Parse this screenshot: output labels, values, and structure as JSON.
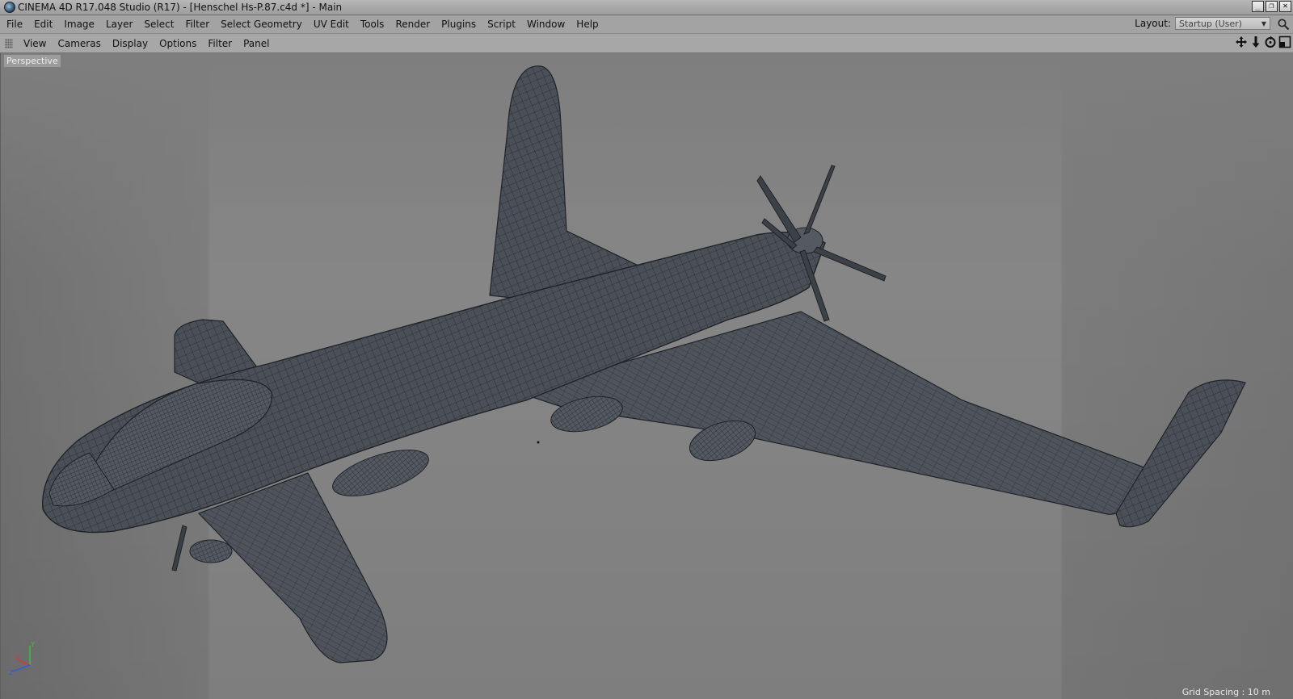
{
  "window": {
    "title": "CINEMA 4D R17.048 Studio (R17) - [Henschel Hs-P.87.c4d *] - Main",
    "controls": [
      "_",
      "❐",
      "✕"
    ]
  },
  "main_menu": {
    "items": [
      "File",
      "Edit",
      "Image",
      "Layer",
      "Select",
      "Filter",
      "Select Geometry",
      "UV Edit",
      "Tools",
      "Render",
      "Plugins",
      "Script",
      "Window",
      "Help"
    ],
    "layout_label": "Layout:",
    "layout_value": "Startup (User)"
  },
  "viewport_menu": {
    "items": [
      "View",
      "Cameras",
      "Display",
      "Options",
      "Filter",
      "Panel"
    ],
    "nav_icons": [
      "move-icon",
      "zoom-icon",
      "rotate-icon",
      "maximize-icon"
    ]
  },
  "viewport": {
    "camera_label": "Perspective",
    "grid_spacing": "Grid Spacing : 10 m",
    "axis_labels": {
      "x": "X",
      "y": "Y",
      "z": "Z"
    },
    "colors": {
      "mesh_fill": "#4b5058",
      "wireframe": "#23272d",
      "background": "#868686"
    }
  }
}
